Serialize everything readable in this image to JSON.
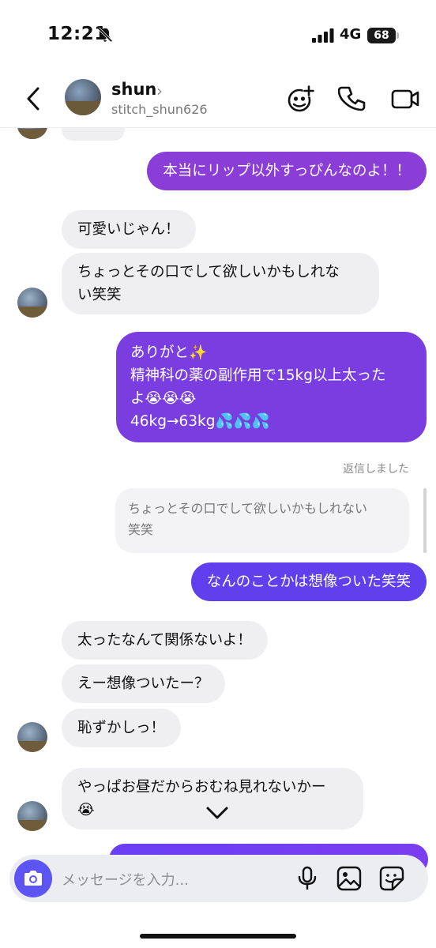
{
  "status_bar": {
    "time": "12:21",
    "network": "4G",
    "battery": "68"
  },
  "header": {
    "name": "shun",
    "chevron": "›",
    "username": "stitch_shun626"
  },
  "icons": {
    "back": "chevron-left-icon",
    "mute": "bell-slash-icon",
    "add_people": "add-people-icon",
    "phone": "phone-icon",
    "video": "video-camera-icon",
    "camera": "camera-icon",
    "mic": "microphone-icon",
    "gallery": "image-icon",
    "sticker": "sticker-icon",
    "scroll_down": "chevron-down-icon"
  },
  "colors": {
    "sent_top": "#8b3dd8",
    "sent_bottom": "#5c41ee",
    "received": "#efeff1",
    "camera_button": "#5c55f3"
  },
  "messages": [
    {
      "dir": "sent",
      "text": "本当にリップ以外すっぴんなのよ！！"
    },
    {
      "dir": "received",
      "text": "可愛いじゃん！"
    },
    {
      "dir": "received",
      "text": "ちょっとその口でして欲しいかもしれな\nい笑笑"
    },
    {
      "dir": "sent",
      "text": "ありがと✨\n精神科の薬の副作用で15kg以上太った\nよ😭😭😭\n46kg→63kg💦💦💦"
    },
    {
      "dir": "sent",
      "text": "なんのことかは想像ついた笑笑"
    },
    {
      "dir": "received",
      "text": "太ったなんて関係ないよ！"
    },
    {
      "dir": "received",
      "text": "えー想像ついたー？"
    },
    {
      "dir": "received",
      "text": "恥ずかしっ！"
    },
    {
      "dir": "received",
      "text": "やっぱお昼だからおむね見れないかー\n😭"
    }
  ],
  "reply": {
    "label": "返信しました",
    "quoted": "ちょっとその口でして欲しいかもしれない\n笑笑"
  },
  "composer": {
    "placeholder": "メッセージを入力..."
  }
}
